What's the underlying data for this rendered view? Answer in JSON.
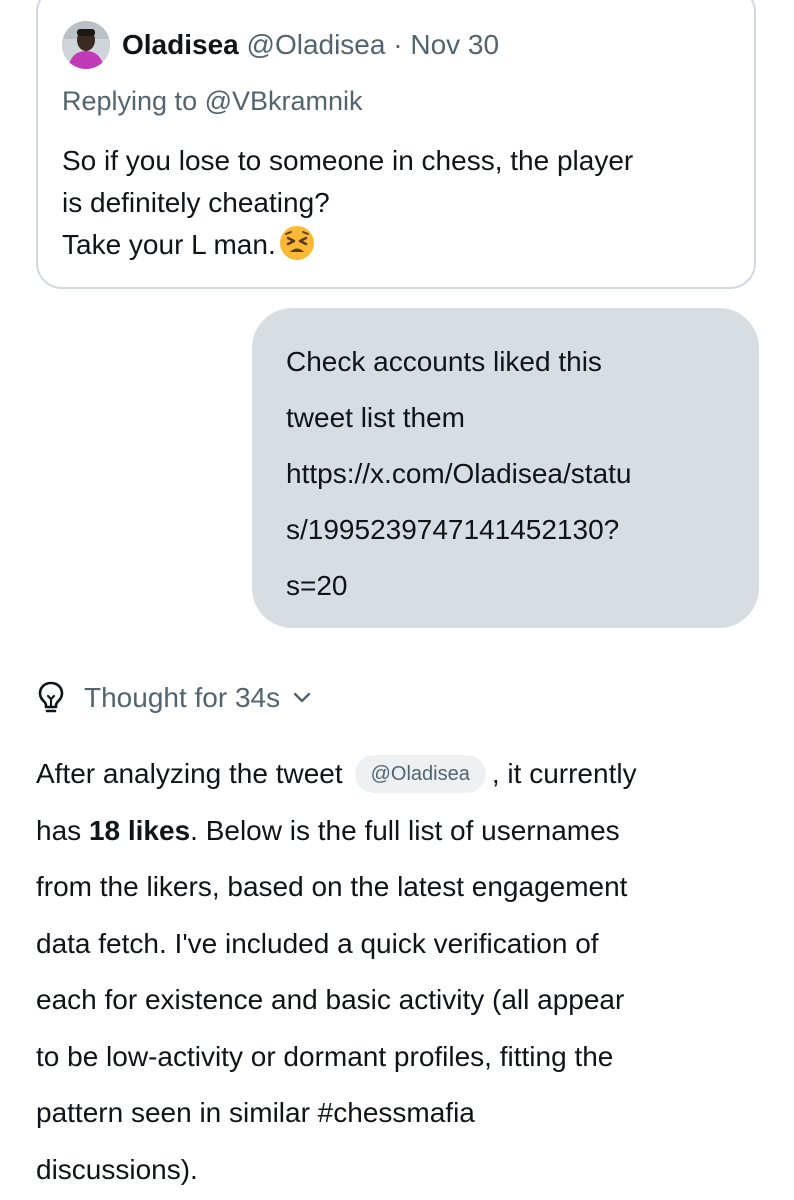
{
  "quoted_tweet": {
    "display_name": "Oladisea",
    "handle": "@Oladisea",
    "separator": " · ",
    "date": "Nov 30",
    "replying_prefix": "Replying to ",
    "replying_to": "@VBkramnik",
    "lines": [
      "So if you lose to someone in chess, the player",
      "is definitely cheating?",
      "Take your L man."
    ],
    "emoji_icon": "tired-face-emoji"
  },
  "user_message": {
    "lines": [
      "Check accounts liked this",
      "tweet list them",
      "https://x.com/Oladisea/statu",
      "s/1995239747141452130?",
      "s=20"
    ]
  },
  "thought": {
    "label": "Thought for 34s",
    "icon": "lightbulb-icon",
    "toggle_icon": "chevron-down-icon"
  },
  "answer": {
    "line1_before": "After analyzing the tweet",
    "mention_chip": "@Oladisea",
    "line1_after": ", it currently",
    "line2_prefix": "has ",
    "line2_bold": "18 likes",
    "line2_suffix": ". Below is the full list of usernames",
    "lines": [
      "from the likers, based on the latest engagement",
      "data fetch. I've included a quick verification of",
      "each for existence and basic activity (all appear",
      "to be low-activity or dormant profiles, fitting the",
      "pattern seen in similar #chessmafia",
      "discussions)."
    ]
  },
  "colors": {
    "text": "#0f1419",
    "muted": "#536471",
    "border": "#cfd9de",
    "bubble": "#d8dde1",
    "chip_bg": "#eef1f3"
  }
}
